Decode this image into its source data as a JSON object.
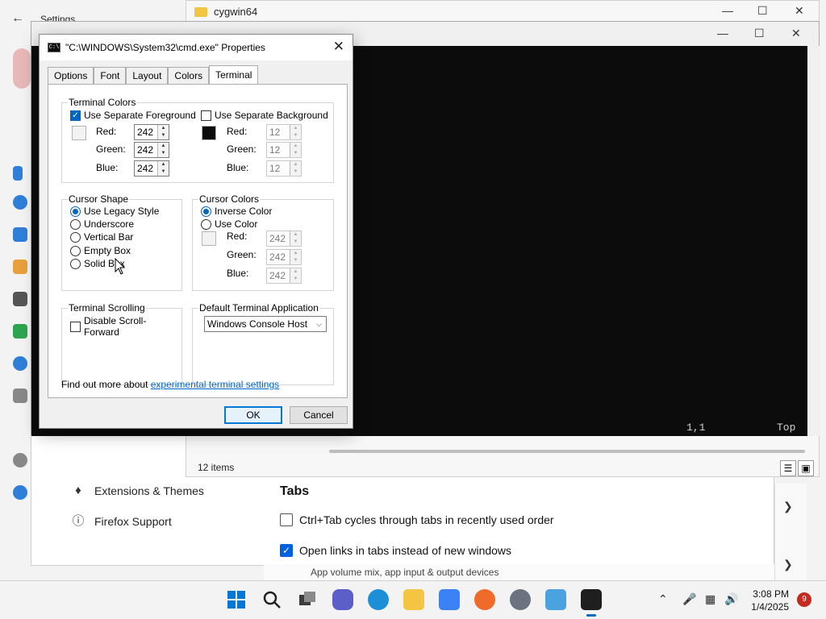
{
  "settings": {
    "title": "Settings"
  },
  "firefox": {
    "nav_items": [
      {
        "label": "Extensions & Themes"
      },
      {
        "label": "Firefox Support"
      }
    ],
    "tabs_heading": "Tabs",
    "options": [
      {
        "label": "Ctrl+Tab cycles through tabs in recently used order",
        "checked": false
      },
      {
        "label": "Open links in tabs instead of new windows",
        "checked": true
      }
    ],
    "app_volume_text": "App volume mix, app input & output devices"
  },
  "explorer": {
    "title": "cygwin64",
    "status": "12 items"
  },
  "terminal": {
    "status_position": "1,1",
    "status_scroll": "Top"
  },
  "dialog": {
    "title": "\"C:\\WINDOWS\\System32\\cmd.exe\" Properties",
    "tabs": [
      "Options",
      "Font",
      "Layout",
      "Colors",
      "Terminal"
    ],
    "active_tab": "Terminal",
    "terminal_colors": {
      "group_label": "Terminal Colors",
      "foreground": {
        "checkbox_label": "Use Separate Foreground",
        "checked": true,
        "red_label": "Red:",
        "red": "242",
        "green_label": "Green:",
        "green": "242",
        "blue_label": "Blue:",
        "blue": "242",
        "swatch_color": "#f2f2f2"
      },
      "background": {
        "checkbox_label": "Use Separate Background",
        "checked": false,
        "red_label": "Red:",
        "red": "12",
        "green_label": "Green:",
        "green": "12",
        "blue_label": "Blue:",
        "blue": "12",
        "swatch_color": "#0c0c0c"
      }
    },
    "cursor_shape": {
      "group_label": "Cursor Shape",
      "options": [
        {
          "label": "Use Legacy Style",
          "selected": true
        },
        {
          "label": "Underscore",
          "selected": false
        },
        {
          "label": "Vertical Bar",
          "selected": false
        },
        {
          "label": "Empty Box",
          "selected": false
        },
        {
          "label": "Solid Box",
          "selected": false
        }
      ]
    },
    "cursor_colors": {
      "group_label": "Cursor Colors",
      "options": [
        {
          "label": "Inverse Color",
          "selected": true
        },
        {
          "label": "Use Color",
          "selected": false
        }
      ],
      "red_label": "Red:",
      "red": "242",
      "green_label": "Green:",
      "green": "242",
      "blue_label": "Blue:",
      "blue": "242",
      "swatch_color": "#f2f2f2"
    },
    "terminal_scrolling": {
      "group_label": "Terminal Scrolling",
      "checkbox_label": "Disable Scroll-Forward",
      "checked": false
    },
    "default_terminal": {
      "group_label": "Default Terminal Application",
      "selected": "Windows Console Host"
    },
    "info_text": "Find out more about ",
    "info_link": "experimental terminal settings",
    "ok_label": "OK",
    "cancel_label": "Cancel"
  },
  "taskbar": {
    "time": "3:08 PM",
    "date": "1/4/2025",
    "notification_count": "9"
  },
  "colors": {
    "accent": "#0067c0",
    "terminal_bg": "#0c0c0c",
    "terminal_text": "#1e2f8e"
  }
}
